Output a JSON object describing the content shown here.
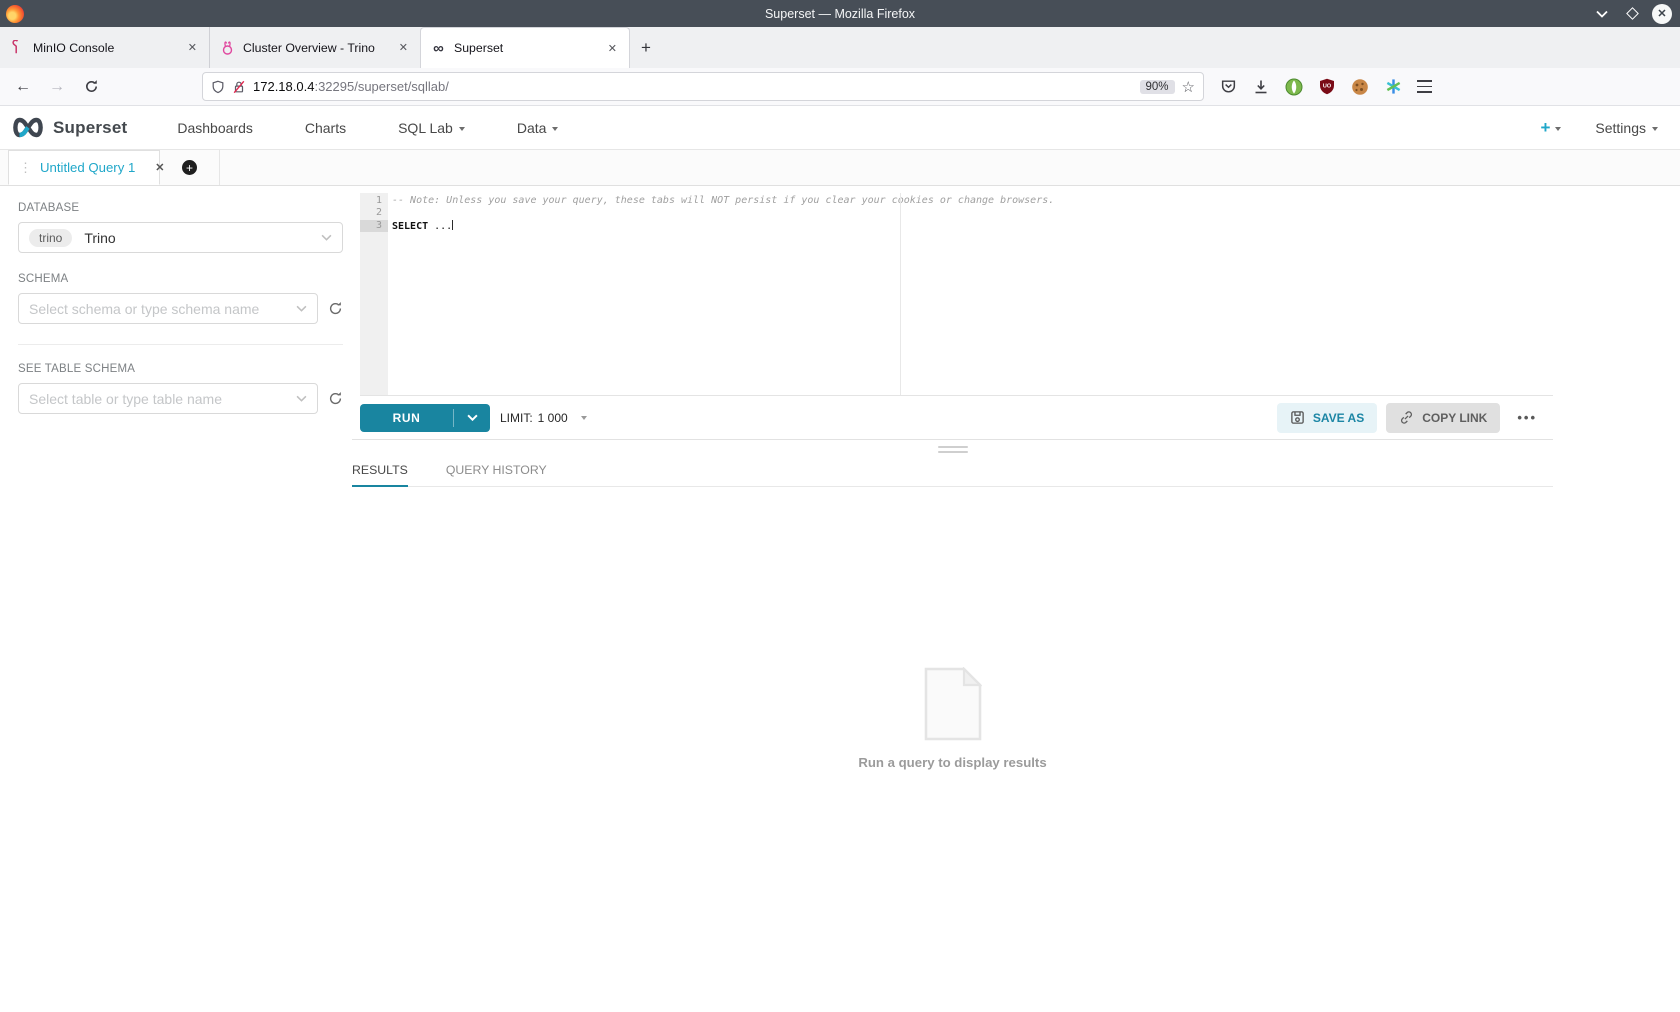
{
  "window": {
    "title": "Superset — Mozilla Firefox"
  },
  "browser_tabs": {
    "tabs": [
      {
        "title": "MinIO Console"
      },
      {
        "title": "Cluster Overview - Trino"
      },
      {
        "title": "Superset"
      }
    ],
    "new_tab_label": "+"
  },
  "address_bar": {
    "url_host": "172.18.0.4",
    "url_path": ":32295/superset/sqllab/",
    "zoom_badge": "90%"
  },
  "app_nav": {
    "brand": "Superset",
    "items": [
      "Dashboards",
      "Charts",
      "SQL Lab",
      "Data"
    ],
    "add_label": "+",
    "settings_label": "Settings"
  },
  "query_tabbar": {
    "tab_title": "Untitled Query 1"
  },
  "sidebar": {
    "database_label": "DATABASE",
    "database_badge": "trino",
    "database_value": "Trino",
    "schema_label": "SCHEMA",
    "schema_placeholder": "Select schema or type schema name",
    "table_label": "SEE TABLE SCHEMA",
    "table_placeholder": "Select table or type table name"
  },
  "editor": {
    "lines": [
      {
        "n": "1",
        "comment": "-- Note: Unless you save your query, these tabs will NOT persist if you clear your cookies or change browsers."
      },
      {
        "n": "2"
      },
      {
        "n": "3",
        "keyword": "SELECT",
        "rest": " ..."
      }
    ]
  },
  "toolbar": {
    "run_label": "RUN",
    "limit_label": "LIMIT:",
    "limit_value": "1 000",
    "save_as_label": "SAVE AS",
    "copy_link_label": "COPY LINK",
    "more_label": "•••"
  },
  "results_panel": {
    "tab_results": "RESULTS",
    "tab_history": "QUERY HISTORY",
    "empty_message": "Run a query to display results"
  },
  "icons": {
    "close": "✕",
    "back": "←",
    "forward": "→",
    "star": "☆",
    "grip": "⋮",
    "plus": "+"
  },
  "colors": {
    "accent": "#20a7c9",
    "run_button": "#1985a0"
  }
}
